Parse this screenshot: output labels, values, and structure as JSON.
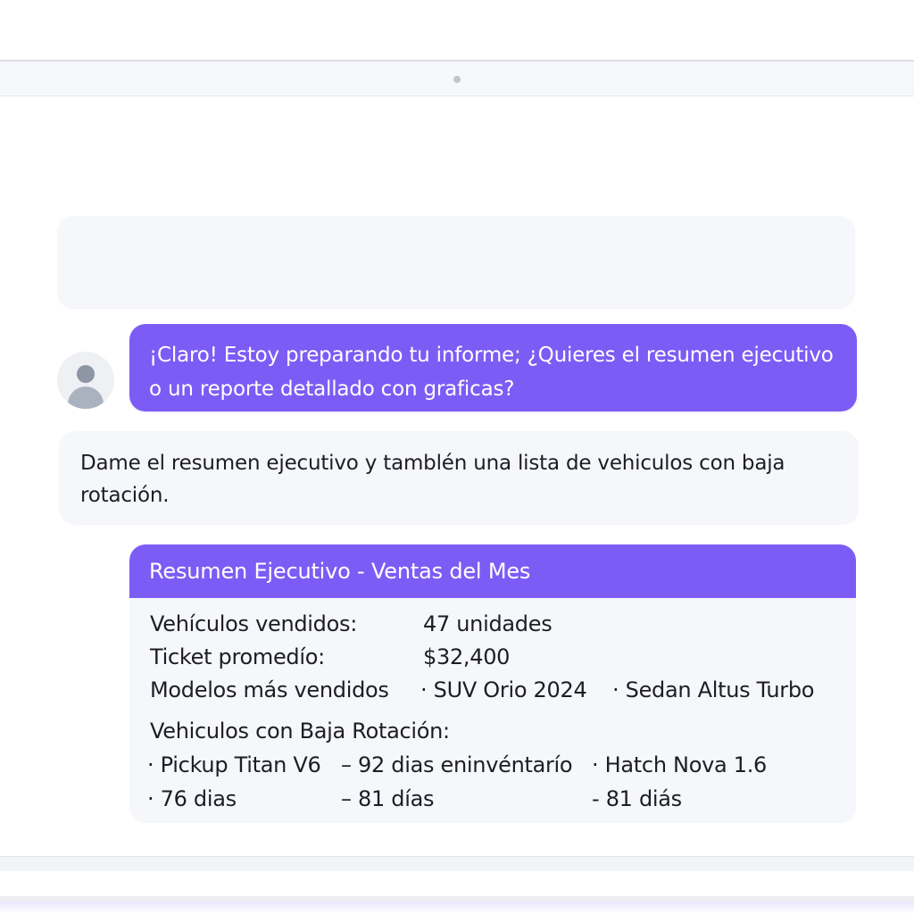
{
  "chat": {
    "assistant_message": "¡Claro! Estoy preparando tu informe; ¿Quieres el resumen ejecutivo o un reporte detallado con graficas?",
    "user_message": "Dame el resumen ejecutivo y tamblén una lista de vehiculos con baja rotación."
  },
  "summary": {
    "title": "Resumen Ejecutivo - Ventas del Mes",
    "rows": [
      {
        "label": "Vehículos vendidos:",
        "value": "47 unidades"
      },
      {
        "label": "Ticket promedío:",
        "value": "$32,400"
      },
      {
        "label": "Modelos más vendidos",
        "values": [
          "· SUV Orio 2024",
          "· Sedan Altus Turbo"
        ]
      }
    ],
    "low_rotation_title": "Vehiculos con Baja Rotación:",
    "low_rotation": [
      [
        "· Pickup Titan V6",
        "– 92 dias eninvéntarío",
        "· Hatch Nova 1.6"
      ],
      [
        "· 76 dias",
        "– 81 días",
        "- 81 diás"
      ]
    ]
  },
  "colors": {
    "accent": "#7c5cf5",
    "bubble_bg": "#f6f7fb",
    "avatar_bg": "#eef0f4"
  },
  "icons": {
    "avatar": "user-avatar-icon"
  }
}
